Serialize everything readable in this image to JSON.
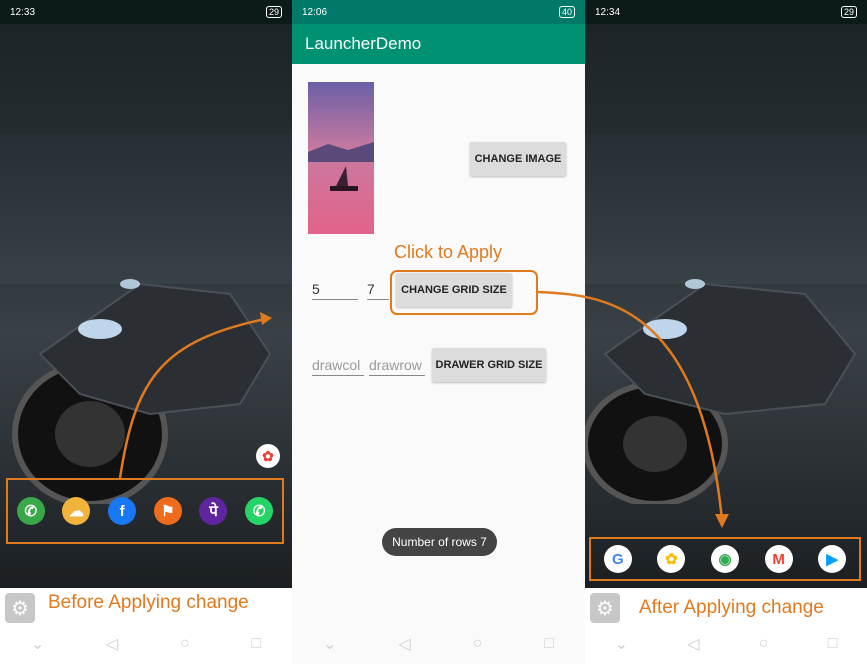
{
  "left_phone": {
    "status_time": "12:33",
    "status_left_extra": ".ıll .ıll ᯤ",
    "status_right": "29",
    "caption": "Before Applying change",
    "dock_apps": [
      {
        "name": "phone",
        "icon": "phone-icon",
        "glyph": "✆",
        "color": "#3aa84a"
      },
      {
        "name": "weather",
        "icon": "weather-icon",
        "glyph": "☁",
        "color": "#f2b33c"
      },
      {
        "name": "facebook",
        "icon": "facebook-icon",
        "glyph": "f",
        "color": "#1877f2"
      },
      {
        "name": "swiggy",
        "icon": "swiggy-icon",
        "glyph": "⚑",
        "color": "#ee6c1b"
      },
      {
        "name": "phonepe",
        "icon": "phonepe-icon",
        "glyph": "पे",
        "color": "#5f259f"
      },
      {
        "name": "whatsapp",
        "icon": "whatsapp-icon",
        "glyph": "✆",
        "color": "#25d366"
      }
    ]
  },
  "middle_phone": {
    "status_time": "12:06",
    "status_right": "40",
    "app_title": "LauncherDemo",
    "change_image_label": "CHANGE IMAGE",
    "click_to_apply": "Click to Apply",
    "grid_col_value": "5",
    "grid_row_value": "7",
    "change_grid_label": "CHANGE GRID SIZE",
    "drawer_col_hint": "drawcol",
    "drawer_row_hint": "drawrow",
    "drawer_grid_label": "DRAWER GRID SIZE",
    "toast": "Number of rows 7"
  },
  "right_phone": {
    "status_time": "12:34",
    "status_right": "29",
    "caption": "After Applying change",
    "dock_apps": [
      {
        "name": "google",
        "icon": "google-icon",
        "glyph": "G",
        "color": "#4285f4"
      },
      {
        "name": "photos",
        "icon": "photos-icon",
        "glyph": "✿",
        "color": "#fbbc05"
      },
      {
        "name": "chrome",
        "icon": "chrome-icon",
        "glyph": "◉",
        "color": "#34a853"
      },
      {
        "name": "gmail",
        "icon": "gmail-icon",
        "glyph": "M",
        "color": "#ea4335"
      },
      {
        "name": "playstore",
        "icon": "play-store-icon",
        "glyph": "▶",
        "color": "#00a0ff"
      }
    ]
  },
  "colors": {
    "accent": "#e07a1f",
    "appbar": "#009173"
  }
}
